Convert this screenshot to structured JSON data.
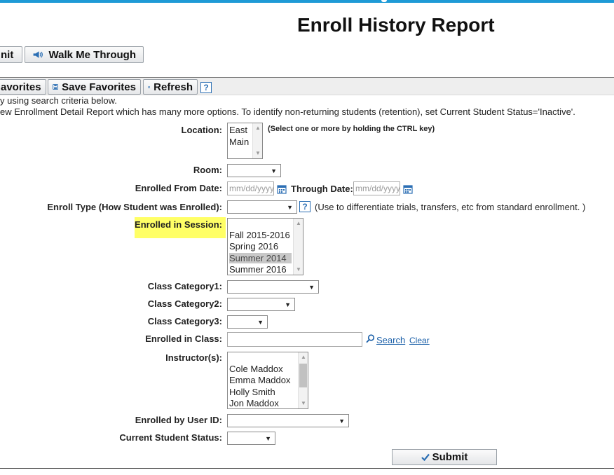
{
  "header": {
    "title": "Enroll History Report"
  },
  "toolbar": {
    "edit_label": "nit",
    "walk_label": "Walk Me Through"
  },
  "favorites_bar": {
    "load_label": "avorites",
    "save_label": "Save Favorites",
    "refresh_label": "Refresh",
    "help_label": "?"
  },
  "info": {
    "line1": "y using search criteria below.",
    "line2": "ew Enrollment Detail Report which has many more options. To identify non-returning students (retention), set Current Student Status='Inactive'."
  },
  "form": {
    "location": {
      "label": "Location:",
      "options": [
        "East",
        "Main"
      ],
      "note": "(Select one or more by holding the CTRL key)"
    },
    "room": {
      "label": "Room:"
    },
    "enrolled_from": {
      "label": "Enrolled From Date:",
      "placeholder": "mm/dd/yyyy"
    },
    "through": {
      "label": "Through Date:",
      "placeholder": "mm/dd/yyyy"
    },
    "enroll_type": {
      "label": "Enroll Type (How Student was Enrolled):",
      "help": "?",
      "note": "(Use to differentiate trials, transfers, etc from standard enrollment. )"
    },
    "session": {
      "label": "Enrolled in Session:",
      "options": [
        "Fall 2015-2016",
        "Spring 2016",
        "Summer 2014",
        "Summer 2016"
      ],
      "selected": "Summer 2014"
    },
    "class_cat1": {
      "label": "Class Category1:"
    },
    "class_cat2": {
      "label": "Class Category2:"
    },
    "class_cat3": {
      "label": "Class Category3:"
    },
    "enrolled_class": {
      "label": "Enrolled in Class:",
      "search_link": "Search",
      "clear_link": "Clear"
    },
    "instructors": {
      "label": "Instructor(s):",
      "options": [
        "Cole Maddox",
        "Emma Maddox",
        "Holly Smith",
        "Jon Maddox"
      ]
    },
    "user_id": {
      "label": "Enrolled by User ID:"
    },
    "status": {
      "label": "Current Student Status:"
    },
    "submit_label": "Submit"
  },
  "colors": {
    "accent": "#1e9ad6",
    "highlight": "#ffff66",
    "link": "#1a5fa8",
    "help": "#2c6fb4"
  },
  "icons": [
    "megaphone-icon",
    "save-icon",
    "refresh-x-icon",
    "help-icon",
    "calendar-icon",
    "search-icon",
    "checkmark-icon"
  ]
}
